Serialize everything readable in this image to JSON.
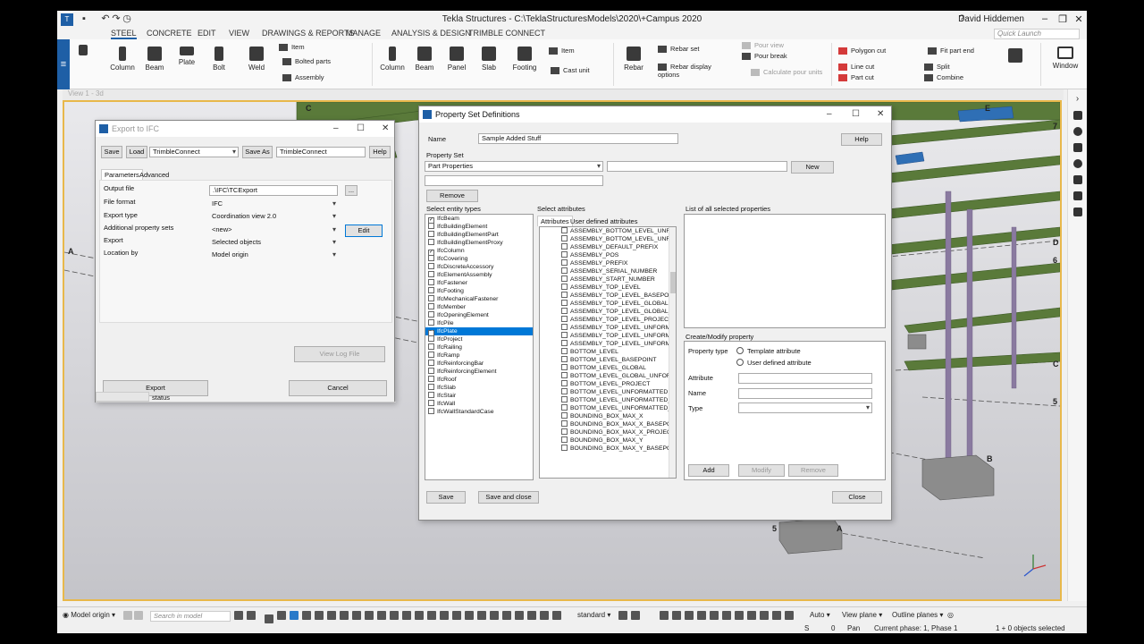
{
  "window": {
    "title": "Tekla Structures - C:\\TeklaStructuresModels\\2020\\+Campus 2020",
    "user": "David Hiddemen",
    "quick_launch_placeholder": "Quick Launch"
  },
  "ribbon_tabs": [
    "STEEL",
    "CONCRETE",
    "EDIT",
    "VIEW",
    "DRAWINGS & REPORTS",
    "MANAGE",
    "ANALYSIS & DESIGN",
    "TRIMBLE CONNECT"
  ],
  "ribbon": {
    "steel": [
      "Column",
      "Beam",
      "Plate",
      "Bolt",
      "Weld"
    ],
    "steel_small": [
      "Item",
      "Bolted parts",
      "Assembly"
    ],
    "concrete": [
      "Column",
      "Beam",
      "Panel",
      "Slab",
      "Footing"
    ],
    "concrete_small": [
      "Item",
      "Cast unit"
    ],
    "rebar": "Rebar",
    "rebar_small": [
      "Rebar set",
      "Rebar display options"
    ],
    "pour_small": [
      "Pour view",
      "Pour break",
      "Calculate pour units"
    ],
    "cut_small": [
      "Polygon cut",
      "Line cut",
      "Part cut"
    ],
    "fit_small": [
      "Fit part end",
      "Split",
      "Combine"
    ],
    "window": "Window"
  },
  "viewport": {
    "label": "View 1 - 3d",
    "grid_labels": [
      "A",
      "B",
      "C",
      "D",
      "E",
      "5",
      "5",
      "6",
      "7",
      "A",
      "B",
      "C"
    ]
  },
  "statusbar": {
    "model_origin": "Model origin",
    "search_placeholder": "Search in model",
    "standard": "standard",
    "auto": "Auto",
    "view_plane": "View plane",
    "outline_planes": "Outline planes",
    "bottom_s": "S",
    "bottom_0": "0",
    "pan": "Pan",
    "phase": "Current phase: 1, Phase 1",
    "selected": "1 + 0 objects selected"
  },
  "export_ifc": {
    "title": "Export to IFC",
    "save": "Save",
    "load": "Load",
    "preset": "TrimbleConnect",
    "save_as": "Save As",
    "save_as_name": "TrimbleConnect",
    "help": "Help",
    "tab_parameters": "Parameters",
    "tab_advanced": "Advanced",
    "output_file_label": "Output file",
    "output_file": ".\\IFC\\TCExport",
    "file_format_label": "File format",
    "file_format": "IFC",
    "export_type_label": "Export type",
    "export_type": "Coordination view 2.0",
    "additional_label": "Additional property sets",
    "additional": "<new>",
    "edit": "Edit",
    "export_label": "Export",
    "export_value": "Selected objects",
    "location_label": "Location by",
    "location": "Model origin",
    "view_log": "View Log File",
    "export_btn": "Export",
    "cancel_btn": "Cancel",
    "status": "status",
    "browse": "..."
  },
  "psd": {
    "title": "Property Set Definitions",
    "name_label": "Name",
    "name_value": "Sample Added Stuff",
    "help": "Help",
    "property_set_label": "Property Set",
    "property_set": "Part Properties",
    "new": "New",
    "remove": "Remove",
    "entity_types_label": "Select entity types",
    "entity_types": [
      {
        "name": "IfcBeam",
        "checked": true
      },
      {
        "name": "IfcBuildingElement",
        "checked": false
      },
      {
        "name": "IfcBuildingElementPart",
        "checked": false
      },
      {
        "name": "IfcBuildingElementProxy",
        "checked": false
      },
      {
        "name": "IfcColumn",
        "checked": true
      },
      {
        "name": "IfcCovering",
        "checked": false
      },
      {
        "name": "IfcDiscreteAccessory",
        "checked": false
      },
      {
        "name": "IfcElementAssembly",
        "checked": false
      },
      {
        "name": "IfcFastener",
        "checked": false
      },
      {
        "name": "IfcFooting",
        "checked": false
      },
      {
        "name": "IfcMechanicalFastener",
        "checked": false
      },
      {
        "name": "IfcMember",
        "checked": false
      },
      {
        "name": "IfcOpeningElement",
        "checked": false
      },
      {
        "name": "IfcPile",
        "checked": false
      },
      {
        "name": "IfcPlate",
        "checked": true,
        "selected": true
      },
      {
        "name": "IfcProject",
        "checked": false
      },
      {
        "name": "IfcRailing",
        "checked": false
      },
      {
        "name": "IfcRamp",
        "checked": false
      },
      {
        "name": "IfcReinforcingBar",
        "checked": false
      },
      {
        "name": "IfcReinforcingElement",
        "checked": false
      },
      {
        "name": "IfcRoof",
        "checked": false
      },
      {
        "name": "IfcSlab",
        "checked": false
      },
      {
        "name": "IfcStair",
        "checked": false
      },
      {
        "name": "IfcWall",
        "checked": false
      },
      {
        "name": "IfcWallStandardCase",
        "checked": false
      }
    ],
    "attributes_label": "Select attributes",
    "tab_attributes": "Attributes",
    "tab_user_defined": "User defined attributes",
    "attributes": [
      "ASSEMBLY_BOTTOM_LEVEL_UNFO",
      "ASSEMBLY_BOTTOM_LEVEL_UNFO",
      "ASSEMBLY_DEFAULT_PREFIX",
      "ASSEMBLY_POS",
      "ASSEMBLY_PREFIX",
      "ASSEMBLY_SERIAL_NUMBER",
      "ASSEMBLY_START_NUMBER",
      "ASSEMBLY_TOP_LEVEL",
      "ASSEMBLY_TOP_LEVEL_BASEPOI",
      "ASSEMBLY_TOP_LEVEL_GLOBAL",
      "ASSEMBLY_TOP_LEVEL_GLOBAL_",
      "ASSEMBLY_TOP_LEVEL_PROJECT",
      "ASSEMBLY_TOP_LEVEL_UNFORM",
      "ASSEMBLY_TOP_LEVEL_UNFORM",
      "ASSEMBLY_TOP_LEVEL_UNFORM",
      "BOTTOM_LEVEL",
      "BOTTOM_LEVEL_BASEPOINT",
      "BOTTOM_LEVEL_GLOBAL",
      "BOTTOM_LEVEL_GLOBAL_UNFOR",
      "BOTTOM_LEVEL_PROJECT",
      "BOTTOM_LEVEL_UNFORMATTED",
      "BOTTOM_LEVEL_UNFORMATTED_",
      "BOTTOM_LEVEL_UNFORMATTED_",
      "BOUNDING_BOX_MAX_X",
      "BOUNDING_BOX_MAX_X_BASEPOI",
      "BOUNDING_BOX_MAX_X_PROJECT",
      "BOUNDING_BOX_MAX_Y",
      "BOUNDING_BOX_MAX_Y_BASEPOI"
    ],
    "list_all_label": "List of all selected properties",
    "create_modify_label": "Create/Modify property",
    "property_type_label": "Property type",
    "template_attribute": "Template attribute",
    "user_defined_attribute": "User defined attribute",
    "attribute_label": "Attribute",
    "name_field_label": "Name",
    "type_label": "Type",
    "add": "Add",
    "modify": "Modify",
    "remove2": "Remove",
    "save": "Save",
    "save_close": "Save and close",
    "close": "Close"
  },
  "colors": {
    "accent": "#1e5fa6",
    "viewport_border": "#e8b84b",
    "steel": "#5a7a3a",
    "column": "#8a7aa0",
    "selection": "#0078d7"
  }
}
